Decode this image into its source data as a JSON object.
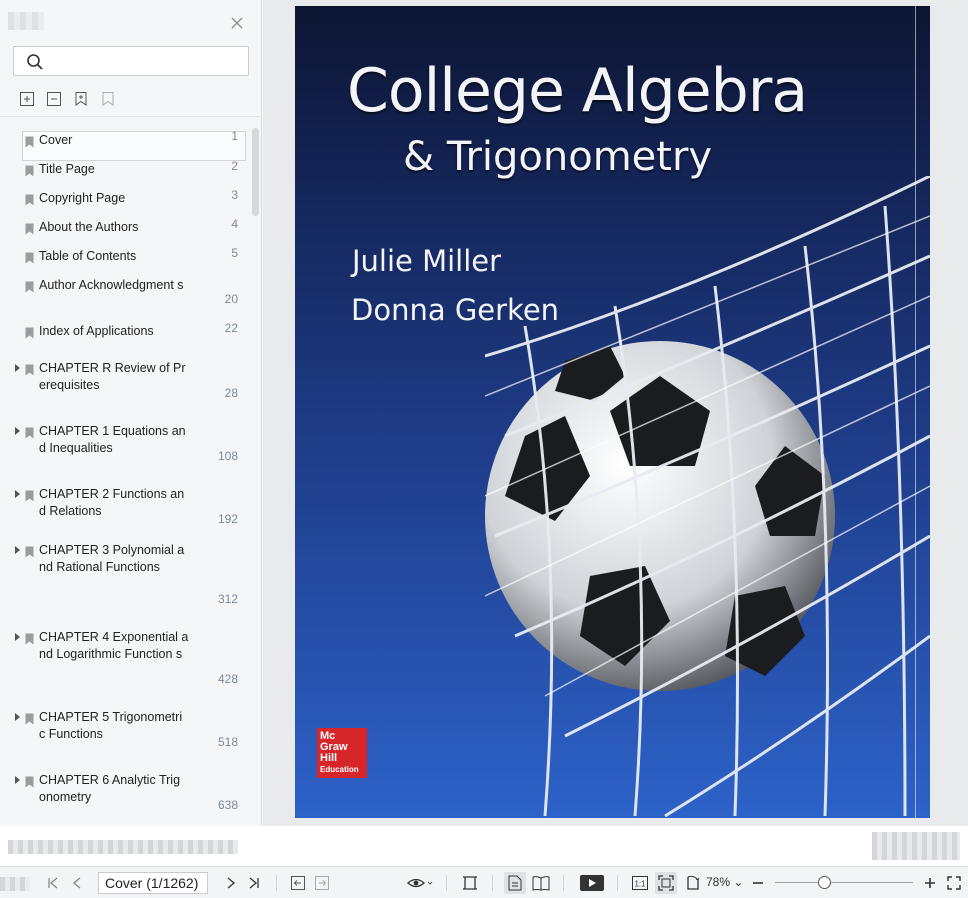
{
  "sidebar": {
    "search": {
      "placeholder": "",
      "value": ""
    },
    "outline": [
      {
        "label": "Cover",
        "page": "1",
        "expandable": false
      },
      {
        "label": "Title Page",
        "page": "2",
        "expandable": false
      },
      {
        "label": "Copyright Page",
        "page": "3",
        "expandable": false
      },
      {
        "label": "About the Authors",
        "page": "4",
        "expandable": false
      },
      {
        "label": "Table of Contents",
        "page": "5",
        "expandable": false
      },
      {
        "label": "Author Acknowledgment s",
        "page": "20",
        "expandable": false
      },
      {
        "label": "Index of Applications",
        "page": "22",
        "expandable": false
      },
      {
        "label": "CHAPTER R Review of Pr erequisites",
        "page": "28",
        "expandable": true
      },
      {
        "label": "CHAPTER 1 Equations an d Inequalities",
        "page": "108",
        "expandable": true
      },
      {
        "label": "CHAPTER 2 Functions an d Relations",
        "page": "192",
        "expandable": true
      },
      {
        "label": "CHAPTER 3 Polynomial a nd Rational Functions",
        "page": "312",
        "expandable": true
      },
      {
        "label": "CHAPTER 4 Exponential and Logarithmic Function s",
        "page": "428",
        "expandable": true
      },
      {
        "label": "CHAPTER 5 Trigonometri c Functions",
        "page": "518",
        "expandable": true
      },
      {
        "label": "CHAPTER 6 Analytic Trig onometry",
        "page": "638",
        "expandable": true
      }
    ]
  },
  "document": {
    "cover": {
      "title": "College Algebra",
      "subtitle": "& Trigonometry",
      "authors": [
        "Julie Miller",
        "Donna Gerken"
      ],
      "publisher": [
        "Mc",
        "Graw",
        "Hill",
        "Education"
      ]
    }
  },
  "bottom_bar": {
    "page_indicator": "Cover (1/1262)",
    "zoom": "78%",
    "zoom_level": 0.78
  },
  "colors": {
    "accent_red": "#d7262a",
    "cover_blue": "#1f3d8a"
  }
}
